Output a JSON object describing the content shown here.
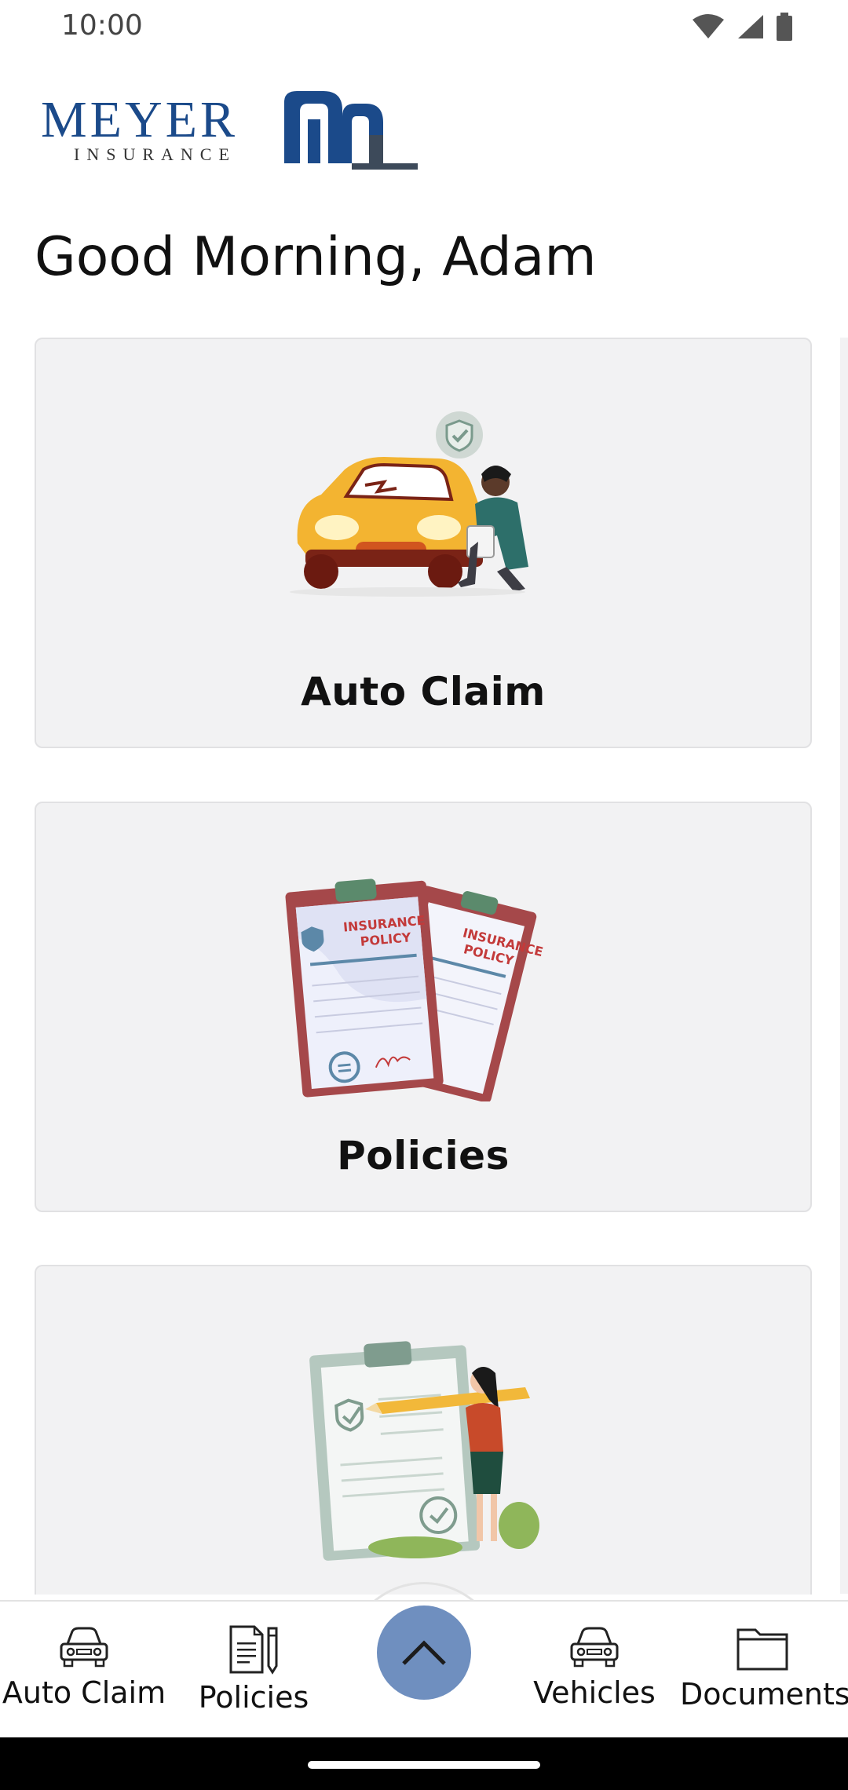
{
  "status_bar": {
    "time": "10:00"
  },
  "brand": {
    "name": "MEYER",
    "subtitle": "INSURANCE",
    "monogram": "mi",
    "primary_color": "#1b4a8a"
  },
  "greeting": "Good Morning, Adam",
  "cards": [
    {
      "label": "Auto Claim",
      "illustration": "car-damage-inspection"
    },
    {
      "label": "Policies",
      "illustration": "insurance-policy-clipboards",
      "doc_text": [
        "INSURANCE",
        "POLICY"
      ]
    },
    {
      "label": "",
      "illustration": "checklist-clipboard-person"
    }
  ],
  "bottom_nav": {
    "items": [
      {
        "label": "Auto Claim",
        "icon": "car-icon"
      },
      {
        "label": "Policies",
        "icon": "document-pencil-icon"
      },
      {
        "label": "Vehicles",
        "icon": "car-icon"
      },
      {
        "label": "Documents",
        "icon": "folder-icon"
      }
    ],
    "fab_icon": "chevron-up-icon",
    "fab_color": "#6f8fbf"
  }
}
